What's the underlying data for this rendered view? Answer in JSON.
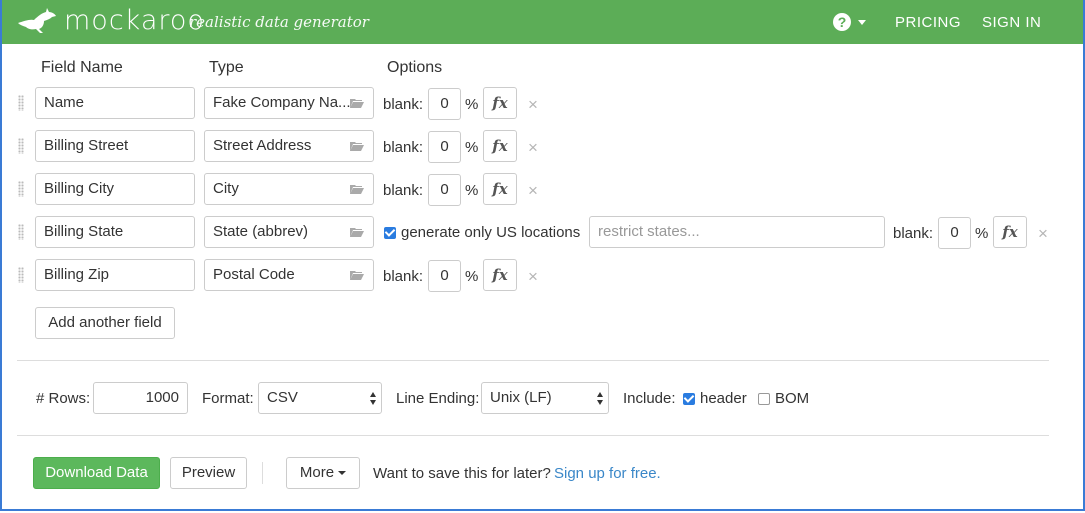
{
  "header": {
    "brand": "mockaroo",
    "tagline": "realistic data generator",
    "help_icon": "question-circle-icon",
    "pricing": "PRICING",
    "sign_in": "SIGN IN",
    "bg_color": "#5cad57"
  },
  "columns": {
    "field_name": "Field Name",
    "type": "Type",
    "options": "Options"
  },
  "fields": [
    {
      "name": "Name",
      "type": "Fake Company Na...",
      "blank_label": "blank:",
      "blank_pct": "0",
      "pct": "%",
      "fx": "fx"
    },
    {
      "name": "Billing Street",
      "type": "Street Address",
      "blank_label": "blank:",
      "blank_pct": "0",
      "pct": "%",
      "fx": "fx"
    },
    {
      "name": "Billing City",
      "type": "City",
      "blank_label": "blank:",
      "blank_pct": "0",
      "pct": "%",
      "fx": "fx"
    },
    {
      "name": "Billing State",
      "type": "State (abbrev)",
      "us_only_label": "generate only US locations",
      "us_only_checked": true,
      "restrict_placeholder": "restrict states...",
      "blank_label": "blank:",
      "blank_pct": "0",
      "pct": "%",
      "fx": "fx"
    },
    {
      "name": "Billing Zip",
      "type": "Postal Code",
      "blank_label": "blank:",
      "blank_pct": "0",
      "pct": "%",
      "fx": "fx"
    }
  ],
  "remove_glyph": "×",
  "add_field": "Add another field",
  "options": {
    "rows_label": "# Rows:",
    "rows_value": "1000",
    "format_label": "Format:",
    "format_value": "CSV",
    "line_ending_label": "Line Ending:",
    "line_ending_value": "Unix (LF)",
    "include_label": "Include:",
    "header_label": "header",
    "header_checked": true,
    "bom_label": "BOM",
    "bom_checked": false
  },
  "actions": {
    "download": "Download Data",
    "preview": "Preview",
    "more": "More",
    "save_prompt": "Want to save this for later?",
    "signup_link": "Sign up for free."
  }
}
